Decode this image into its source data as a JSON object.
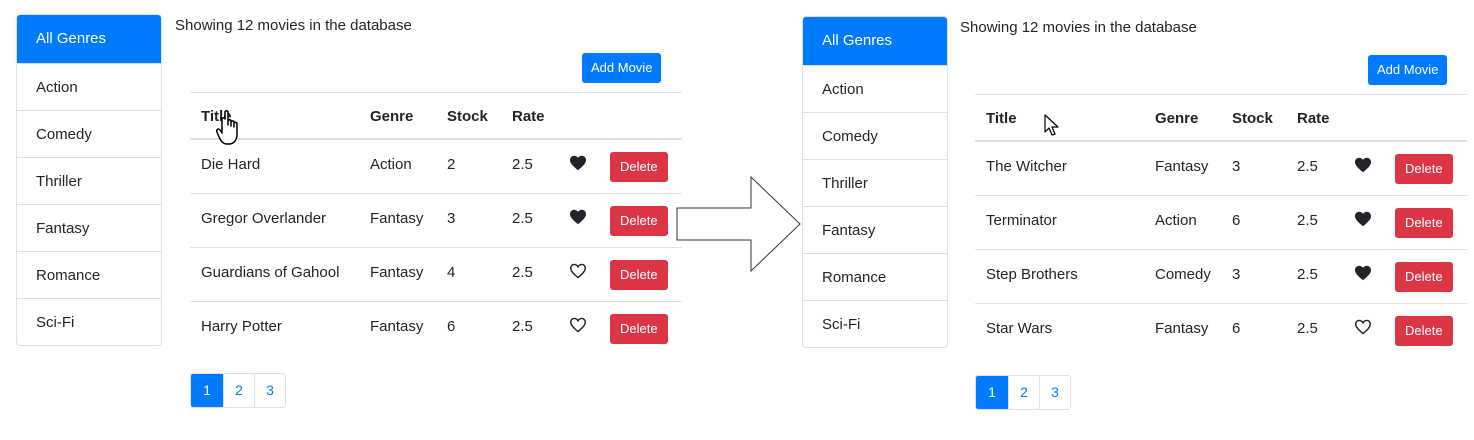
{
  "left": {
    "genres": [
      "All Genres",
      "Action",
      "Comedy",
      "Thriller",
      "Fantasy",
      "Romance",
      "Sci-Fi"
    ],
    "active_genre_index": 0,
    "count_text": "Showing 12 movies in the database",
    "add_button": "Add Movie",
    "columns": [
      "Title",
      "Genre",
      "Stock",
      "Rate"
    ],
    "rows": [
      {
        "title": "Die Hard",
        "genre": "Action",
        "stock": "2",
        "rate": "2.5",
        "liked": true,
        "delete": "Delete"
      },
      {
        "title": "Gregor Overlander",
        "genre": "Fantasy",
        "stock": "3",
        "rate": "2.5",
        "liked": true,
        "delete": "Delete"
      },
      {
        "title": "Guardians of Gahool",
        "genre": "Fantasy",
        "stock": "4",
        "rate": "2.5",
        "liked": false,
        "delete": "Delete"
      },
      {
        "title": "Harry Potter",
        "genre": "Fantasy",
        "stock": "6",
        "rate": "2.5",
        "liked": false,
        "delete": "Delete"
      }
    ],
    "pages": [
      "1",
      "2",
      "3"
    ],
    "active_page_index": 0
  },
  "right": {
    "genres": [
      "All Genres",
      "Action",
      "Comedy",
      "Thriller",
      "Fantasy",
      "Romance",
      "Sci-Fi"
    ],
    "active_genre_index": 0,
    "count_text": "Showing 12 movies in the database",
    "add_button": "Add Movie",
    "columns": [
      "Title",
      "Genre",
      "Stock",
      "Rate"
    ],
    "rows": [
      {
        "title": "The Witcher",
        "genre": "Fantasy",
        "stock": "3",
        "rate": "2.5",
        "liked": true,
        "delete": "Delete"
      },
      {
        "title": "Terminator",
        "genre": "Action",
        "stock": "6",
        "rate": "2.5",
        "liked": true,
        "delete": "Delete"
      },
      {
        "title": "Step Brothers",
        "genre": "Comedy",
        "stock": "3",
        "rate": "2.5",
        "liked": true,
        "delete": "Delete"
      },
      {
        "title": "Star Wars",
        "genre": "Fantasy",
        "stock": "6",
        "rate": "2.5",
        "liked": false,
        "delete": "Delete"
      }
    ],
    "pages": [
      "1",
      "2",
      "3"
    ],
    "active_page_index": 0
  },
  "icons": {
    "like_filled": "heart-filled-icon",
    "like_empty": "heart-outline-icon",
    "transition": "right-arrow-icon",
    "hand_cursor": "hand-pointer-cursor-icon",
    "arrow_cursor": "arrow-pointer-cursor-icon"
  },
  "colors": {
    "primary": "#007bff",
    "danger": "#dc3545",
    "border": "#dee2e6",
    "text": "#212529"
  }
}
